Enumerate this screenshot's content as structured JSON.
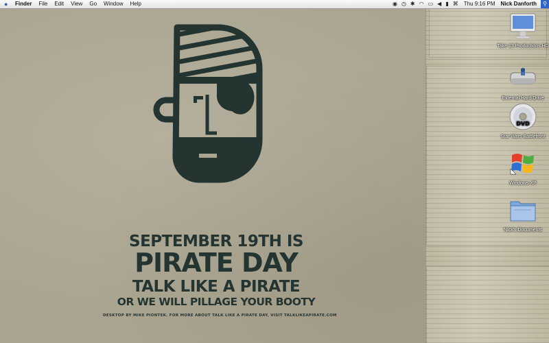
{
  "menubar": {
    "apple_glyph": "",
    "app_name": "Finder",
    "menus": [
      "File",
      "Edit",
      "View",
      "Go",
      "Window",
      "Help"
    ],
    "clock": "Thu 9:16 PM",
    "user": "Nick Danforth"
  },
  "poster": {
    "line1": "SEPTEMBER 19TH IS",
    "line2": "PIRATE DAY",
    "line3": "TALK LIKE A PIRATE",
    "line4": "OR WE WILL PILLAGE YOUR BOOTY",
    "credit": "DESKTOP BY MIKE PIONTEK. FOR MORE ABOUT TALK LIKE A PIRATE DAY, VISIT TALKLIKEAPIRATE.COM"
  },
  "desktop_icons": [
    {
      "label": "Take 13 Productions HD",
      "icon": "imac-icon"
    },
    {
      "label": "External Hard Drive",
      "icon": "hard-drive-icon"
    },
    {
      "label": "Star Wars Battlefront",
      "icon": "dvd-icon"
    },
    {
      "label": "Windows XP",
      "icon": "windows-xp-icon"
    },
    {
      "label": "Nick's Documents",
      "icon": "folder-icon"
    }
  ],
  "colors": {
    "poster_ink": "#243431",
    "wallpaper": "#aaa591"
  }
}
